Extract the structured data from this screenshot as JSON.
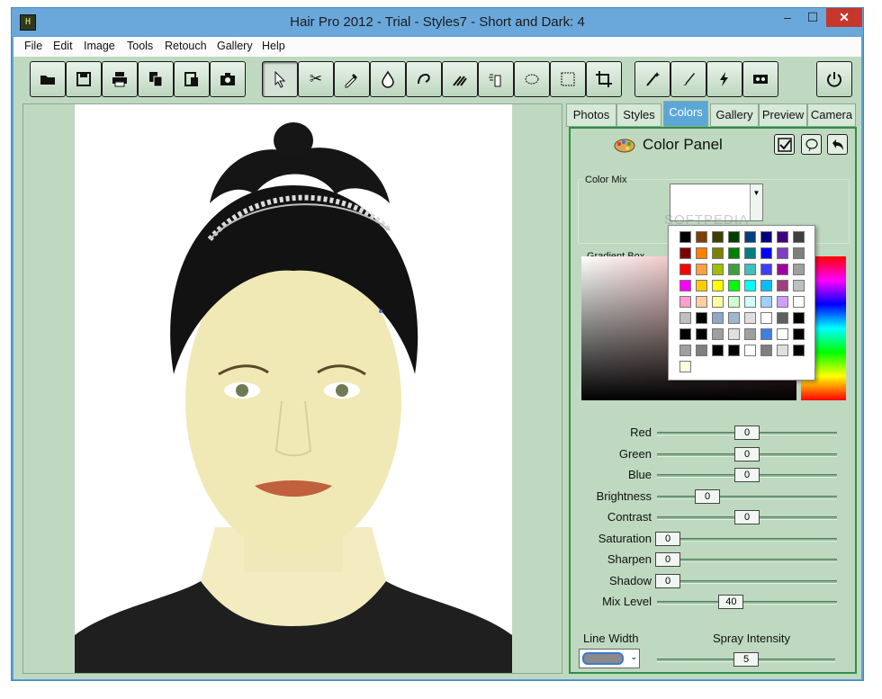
{
  "window": {
    "title": "Hair Pro 2012 - Trial - Styles7 - Short and Dark: 4",
    "minimize": "‒",
    "maximize": "☐",
    "close": "✕"
  },
  "menu": [
    "File",
    "Edit",
    "Image",
    "Tools",
    "Retouch",
    "Gallery",
    "Help"
  ],
  "tabs": [
    "Photos",
    "Styles",
    "Colors",
    "Gallery",
    "Preview",
    "Camera"
  ],
  "active_tab": "Colors",
  "panel": {
    "title": "Color Panel",
    "color_mix_label": "Color Mix",
    "gradient_label": "Gradient Box",
    "watermark": "SOFTPEDIA"
  },
  "sliders": [
    {
      "label": "Red",
      "value": "0"
    },
    {
      "label": "Green",
      "value": "0"
    },
    {
      "label": "Blue",
      "value": "0"
    },
    {
      "label": "Brightness",
      "value": "0"
    },
    {
      "label": "Contrast",
      "value": "0"
    },
    {
      "label": "Saturation",
      "value": "0"
    },
    {
      "label": "Sharpen",
      "value": "0"
    },
    {
      "label": "Shadow",
      "value": "0"
    },
    {
      "label": "Mix Level",
      "value": "40"
    }
  ],
  "slider_levels": [
    0.5,
    0.5,
    0.5,
    0.25,
    0.5,
    0.0,
    0.0,
    0.0,
    0.4
  ],
  "line_width_label": "Line Width",
  "spray": {
    "label": "Spray Intensity",
    "value": "5",
    "level": 0.5
  },
  "palette_colors": [
    [
      "#000000",
      "#7f3f00",
      "#3f3f00",
      "#003f00",
      "#003f7f",
      "#00007f",
      "#3f007f",
      "#3f3f3f"
    ],
    [
      "#7f0000",
      "#ff7f00",
      "#7f7f00",
      "#007f00",
      "#007f7f",
      "#0000ff",
      "#7f3fbf",
      "#7f7f7f"
    ],
    [
      "#ff0000",
      "#ff9f3f",
      "#9fbf00",
      "#3f9f3f",
      "#3fbfbf",
      "#3f3fff",
      "#9f009f",
      "#9f9f9f"
    ],
    [
      "#ff00ff",
      "#ffcc00",
      "#ffff00",
      "#00ff00",
      "#00ffff",
      "#00bfff",
      "#9f3f7f",
      "#bfbfbf"
    ],
    [
      "#ff9fcf",
      "#ffcf9f",
      "#ffff9f",
      "#cfffcf",
      "#cfffff",
      "#9fcfff",
      "#cf9fff",
      "#ffffff"
    ]
  ],
  "palette_custom": [
    [
      "#bfbfbf",
      "#000000",
      "#8fa8c8",
      "#9fb8d0",
      "#dfdfdf",
      "#ffffff",
      "#5f5f5f",
      "#000000"
    ],
    [
      "#000000",
      "#000000",
      "#9f9f9f",
      "#e0e0e0",
      "#9f9f9f",
      "#3f7fdf",
      "#ffffff",
      "#000000"
    ],
    [
      "#9f9f9f",
      "#7f7f7f",
      "#000000",
      "#000000",
      "#ffffff",
      "#7f7f7f",
      "#dfdfdf",
      "#000000"
    ],
    [
      "#ffffdf"
    ]
  ],
  "toolbar_icons": [
    "open-folder-icon",
    "save-disk-icon",
    "print-icon",
    "copy-icon",
    "paste-icon",
    "camera-icon",
    "pointer-arrow-icon",
    "scissors-icon",
    "eyedropper-icon",
    "drop-icon",
    "lasso-hair-icon",
    "brush-strokes-icon",
    "spray-icon",
    "freehand-select-icon",
    "rect-select-icon",
    "crop-icon",
    "magic-wand-icon",
    "paint-brush-icon",
    "lightning-icon",
    "tape-icon",
    "power-icon"
  ]
}
